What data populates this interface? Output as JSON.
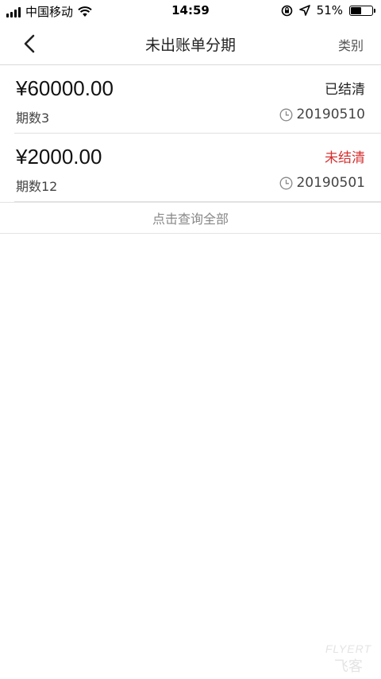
{
  "status_bar": {
    "carrier": "中国移动",
    "time": "14:59",
    "battery_percent": "51%",
    "battery_level": 0.51
  },
  "nav": {
    "title": "未出账单分期",
    "right_label": "类别"
  },
  "bills": [
    {
      "amount": "¥60000.00",
      "status": "已结清",
      "periods": "期数3",
      "date": "20190510"
    },
    {
      "amount": "¥2000.00",
      "status": "未结清",
      "periods": "期数12",
      "date": "20190501"
    }
  ],
  "query_all_label": "点击查询全部",
  "watermark": {
    "top": "FLYERT",
    "bottom": "飞客"
  },
  "colors": {
    "unsettled": "#d72f2f",
    "divider": "#e0e0e0"
  }
}
